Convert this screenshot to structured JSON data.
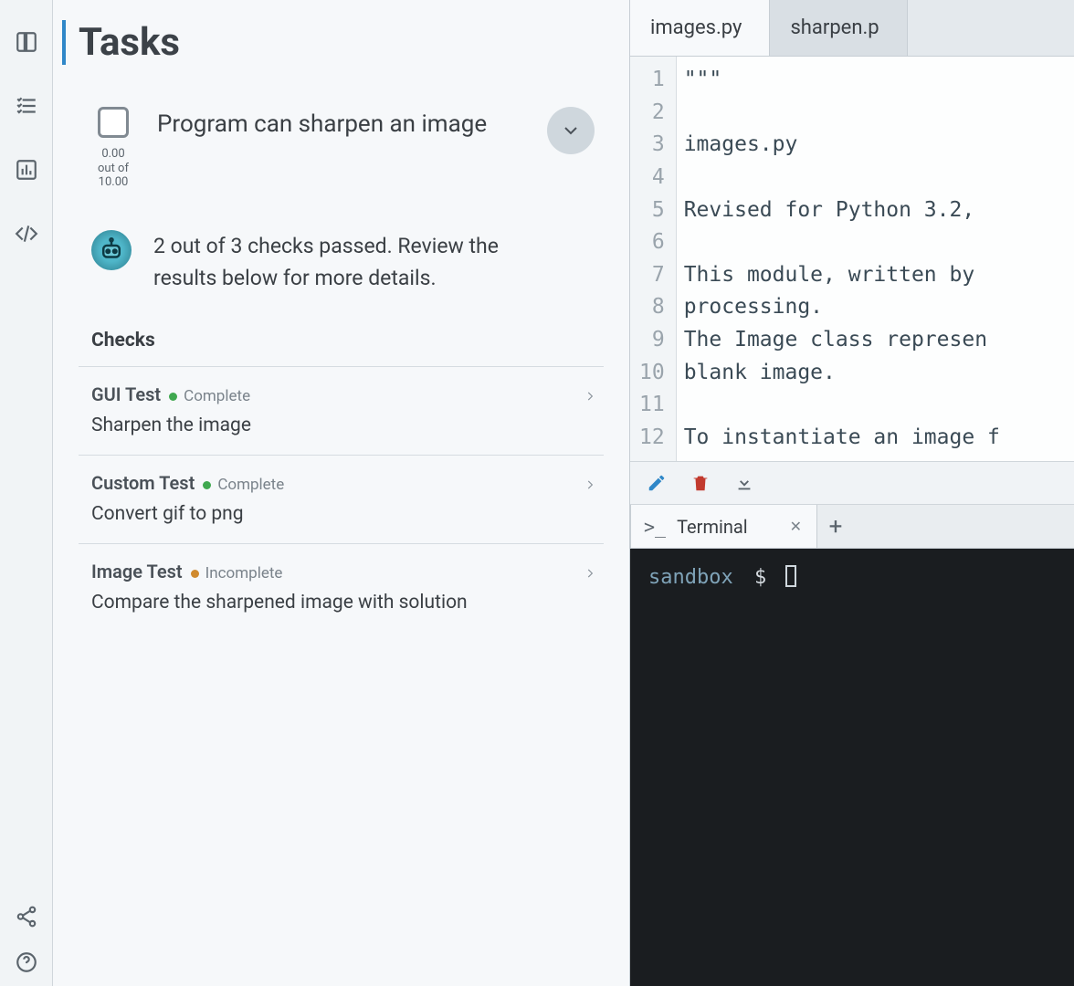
{
  "panel_title": "Tasks",
  "task": {
    "title": "Program can sharpen an image",
    "score_earned": "0.00",
    "score_middle": "out of",
    "score_total": "10.00",
    "summary": "2 out of 3 checks passed. Review the results below for more details."
  },
  "checks_heading": "Checks",
  "checks": [
    {
      "name": "GUI Test",
      "status": "Complete",
      "status_kind": "green",
      "desc": "Sharpen the image"
    },
    {
      "name": "Custom Test",
      "status": "Complete",
      "status_kind": "green",
      "desc": "Convert gif to png"
    },
    {
      "name": "Image Test",
      "status": "Incomplete",
      "status_kind": "orange",
      "desc": "Compare the sharpened image with solution"
    }
  ],
  "tabs": [
    {
      "label": "images.py",
      "active": true
    },
    {
      "label": "sharpen.p",
      "active": false
    }
  ],
  "code_lines": [
    "\"\"\"",
    "",
    "images.py",
    "",
    "Revised for Python 3.2,",
    "",
    "This module, written by",
    "processing.",
    "The Image class represen",
    "blank image.",
    "",
    "To instantiate an image f"
  ],
  "terminal": {
    "tab_label": "Terminal",
    "prompt_path": "sandbox",
    "prompt_symbol": "$"
  }
}
